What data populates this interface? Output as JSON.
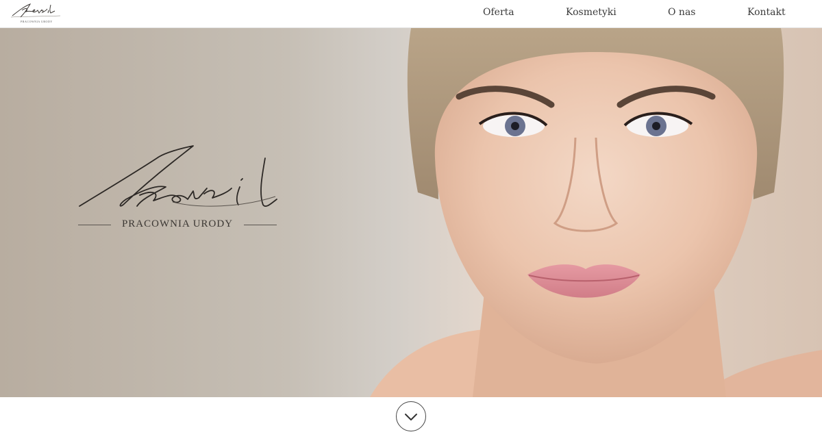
{
  "brand": {
    "logo_script": "Reveil",
    "tagline": "PRACOWNIA URODY",
    "small_tagline": "PRACOWNIA URODY"
  },
  "nav": {
    "items": [
      {
        "label": "Oferta"
      },
      {
        "label": "Kosmetyki"
      },
      {
        "label": "O nas"
      },
      {
        "label": "Kontakt"
      }
    ]
  },
  "hero": {
    "scroll_icon": "chevron-down-icon",
    "image_icon": "portrait-photo"
  },
  "colors": {
    "hero_left": "#b8ada0",
    "hero_right": "#d7c3b3",
    "text": "#3a3a3a"
  }
}
